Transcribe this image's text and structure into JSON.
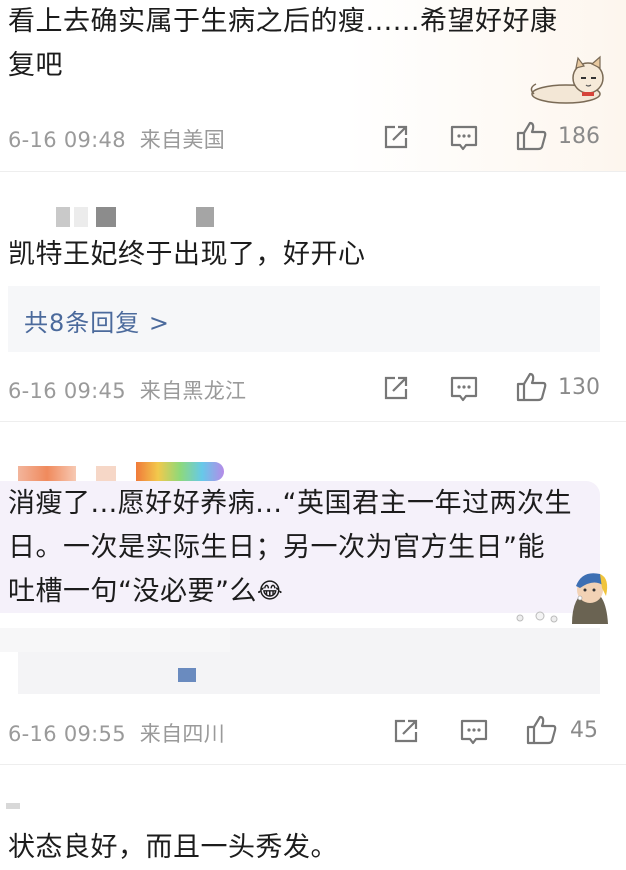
{
  "comments": [
    {
      "text_line1": "看上去确实属于生病之后的瘦......希望好好康",
      "text_line2": "复吧",
      "meta": "6-16 09:48  来自美国",
      "likes": "186"
    },
    {
      "text": "凯特王妃终于出现了，好开心",
      "replies_label": "共8条回复 >",
      "meta": "6-16 09:45  来自黑龙江",
      "likes": "130"
    },
    {
      "text_line1": "消瘦了...愿好好养病...“英国君主一年过两次生",
      "text_line2": "日。一次是实际生日；另一次为官方生日”能",
      "text_line3": "吐槽一句“没必要”么",
      "emoji": "😂",
      "meta": "6-16 09:55  来自四川",
      "likes": "45"
    },
    {
      "text": "状态良好，而且一头秀发。"
    }
  ],
  "icons": {
    "share": "share-icon",
    "reply": "comment-icon",
    "like": "thumbs-up-icon"
  }
}
